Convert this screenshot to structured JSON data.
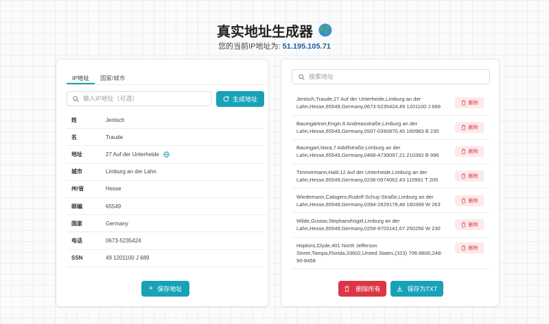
{
  "header": {
    "title": "真实地址生成器",
    "ip_label": "您的当前IP地址为:",
    "ip_value": "51.195.105.71"
  },
  "left_panel": {
    "tabs": [
      {
        "label": "IP地址",
        "active": true
      },
      {
        "label": "国家/城市",
        "active": false
      }
    ],
    "ip_input": {
      "placeholder": "输入IP地址（可选）",
      "value": ""
    },
    "generate_button": "生成地址",
    "fields": [
      {
        "key": "姓",
        "value": "Jentsch"
      },
      {
        "key": "名",
        "value": "Traude"
      },
      {
        "key": "地址",
        "value": "27 Auf der Unterheide"
      },
      {
        "key": "城市",
        "value": "Limburg an der Lahn"
      },
      {
        "key": "州/省",
        "value": "Hesse"
      },
      {
        "key": "邮编",
        "value": "65549"
      },
      {
        "key": "国家",
        "value": "Germany"
      },
      {
        "key": "电话",
        "value": "0673-5235424"
      },
      {
        "key": "SSN",
        "value": "49 1201100 J 689"
      }
    ],
    "save_button": "保存地址"
  },
  "right_panel": {
    "search": {
      "placeholder": "搜索地址",
      "value": ""
    },
    "delete_label": "删除",
    "addresses": [
      "Jentsch,Traude,27 Auf der Unterheide,Limburg an der Lahn,Hesse,65549,Germany,0673-5235424,49 1201100 J 689",
      "Baumgärtner,Engin,6 Andreasstraße,Limburg an der Lahn,Hesse,65549,Germany,0507-0390870,45 160983 B 230",
      "Baumgart,Nora,7 Adolfstraße,Limburg an der Lahn,Hesse,65549,Germany,0468-4739097,21 210392 B 996",
      "Timmermann,Halil,12 Auf der Unterheide,Limburg an der Lahn,Hesse,65549,Germany,0236-0974062,43 110991 T 205",
      "Wiedemann,Calogero,Rudolf-Schuy-Straße,Limburg an der Lahn,Hesse,65549,Germany,0394-2629178,48 160399 W 263",
      "Wilde,Gustav,Stephanshügel,Limburg an der Lahn,Hesse,65549,Germany,0259-9703141,67 250256 W 230",
      "Hopkins,Clyde,401 North Jefferson Street,Tampa,Florida,33602,United States,(323) 706-8830,248-90-8458"
    ],
    "delete_all_button": "删除所有",
    "save_txt_button": "保存为TXT"
  },
  "colors": {
    "accent": "#17a2b8",
    "danger": "#dc3545",
    "danger_light": "#fde8ea",
    "ip_link": "#1a5f9e"
  }
}
